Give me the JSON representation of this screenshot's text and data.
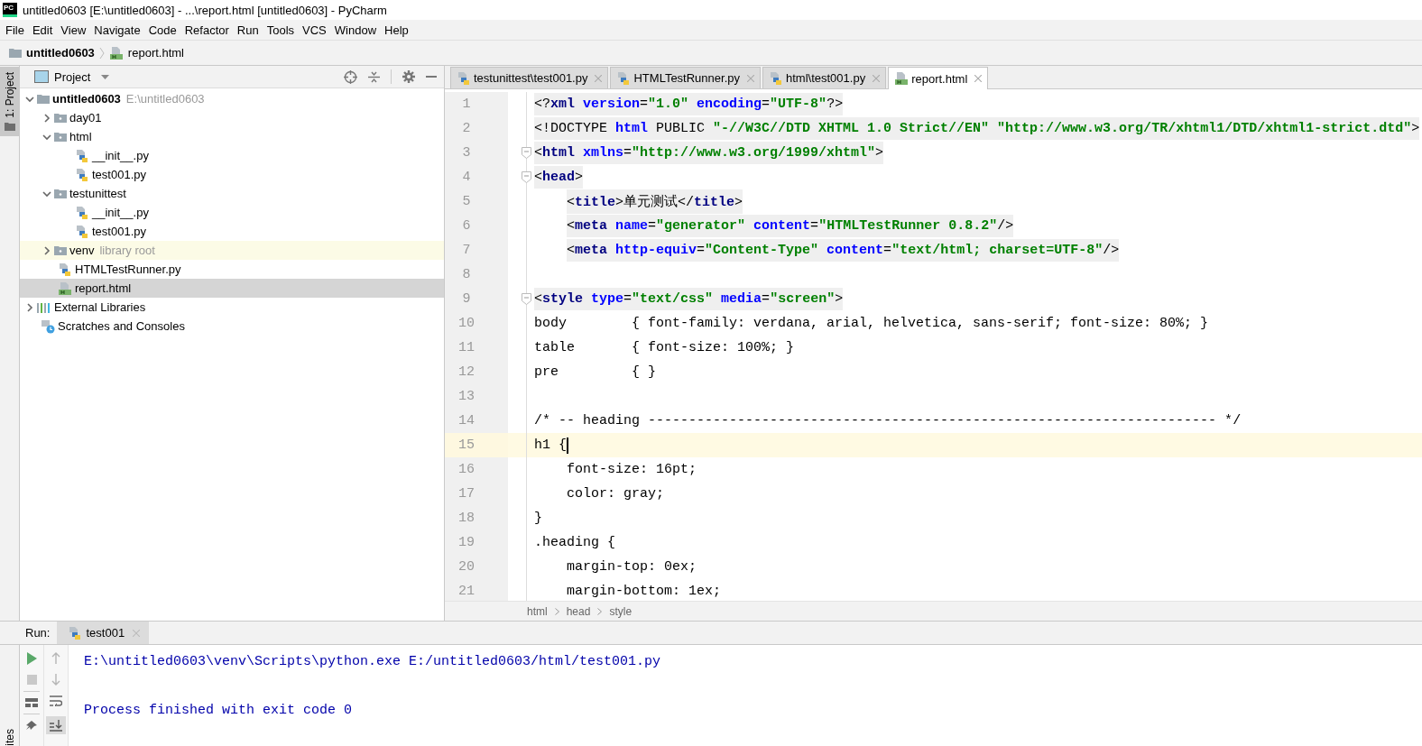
{
  "window": {
    "logo": "PC",
    "title": "untitled0603 [E:\\untitled0603] - ...\\report.html [untitled0603] - PyCharm"
  },
  "menu": [
    "File",
    "Edit",
    "View",
    "Navigate",
    "Code",
    "Refactor",
    "Run",
    "Tools",
    "VCS",
    "Window",
    "Help"
  ],
  "navigation": {
    "project": "untitled0603",
    "file": "report.html"
  },
  "left_stripe": {
    "tool": "1: Project",
    "bottom_tool": "ites"
  },
  "project_panel": {
    "title": "Project",
    "tree": [
      {
        "label": "untitled0603",
        "path": "E:\\untitled0603",
        "kind": "project",
        "expanded": true,
        "selected": false,
        "children": [
          {
            "label": "day01",
            "kind": "folder",
            "expanded": false,
            "selected": false
          },
          {
            "label": "html",
            "kind": "folder",
            "expanded": true,
            "selected": false,
            "children": [
              {
                "label": "__init__.py",
                "kind": "python",
                "selected": false
              },
              {
                "label": "test001.py",
                "kind": "python",
                "selected": false
              }
            ]
          },
          {
            "label": "testunittest",
            "kind": "folder",
            "expanded": true,
            "selected": false,
            "children": [
              {
                "label": "__init__.py",
                "kind": "python",
                "selected": false
              },
              {
                "label": "test001.py",
                "kind": "python",
                "selected": false
              }
            ]
          },
          {
            "label": "venv",
            "note": "library root",
            "kind": "folder",
            "expanded": false,
            "selected": false
          },
          {
            "label": "HTMLTestRunner.py",
            "kind": "python",
            "selected": false
          },
          {
            "label": "report.html",
            "kind": "html",
            "selected": true
          }
        ]
      },
      {
        "label": "External Libraries",
        "kind": "libraries",
        "expanded": false,
        "selected": false
      },
      {
        "label": "Scratches and Consoles",
        "kind": "scratches",
        "selected": false
      }
    ]
  },
  "editor": {
    "tabs": [
      {
        "label": "testunittest\\test001.py",
        "kind": "python",
        "selected": false
      },
      {
        "label": "HTMLTestRunner.py",
        "kind": "python",
        "selected": false
      },
      {
        "label": "html\\test001.py",
        "kind": "python",
        "selected": false
      },
      {
        "label": "report.html",
        "kind": "html",
        "selected": true
      }
    ],
    "lines": [
      {
        "number": "1",
        "shaded": true,
        "current": false,
        "fold": false,
        "tokens": [
          {
            "kind": "punct",
            "text": "<?"
          },
          {
            "kind": "tag",
            "text": "xml "
          },
          {
            "kind": "attr",
            "text": "version"
          },
          {
            "kind": "punct",
            "text": "="
          },
          {
            "kind": "str",
            "text": "\"1.0\" "
          },
          {
            "kind": "attr",
            "text": "encoding"
          },
          {
            "kind": "punct",
            "text": "="
          },
          {
            "kind": "str",
            "text": "\"UTF-8\""
          },
          {
            "kind": "punct",
            "text": "?>"
          }
        ]
      },
      {
        "number": "2",
        "shaded": true,
        "current": false,
        "fold": false,
        "tokens": [
          {
            "kind": "punct",
            "text": "<!DOCTYPE "
          },
          {
            "kind": "attr",
            "text": "html"
          },
          {
            "kind": "punct",
            "text": " PUBLIC "
          },
          {
            "kind": "str",
            "text": "\"-//W3C//DTD XHTML 1.0 Strict//EN\" \"http://www.w3.org/TR/xhtml1/DTD/xhtml1-strict.dtd\""
          },
          {
            "kind": "punct",
            "text": ">"
          }
        ]
      },
      {
        "number": "3",
        "shaded": true,
        "current": false,
        "fold": true,
        "tokens": [
          {
            "kind": "punct",
            "text": "<"
          },
          {
            "kind": "tag",
            "text": "html "
          },
          {
            "kind": "attr",
            "text": "xmlns"
          },
          {
            "kind": "punct",
            "text": "="
          },
          {
            "kind": "str",
            "text": "\"http://www.w3.org/1999/xhtml\""
          },
          {
            "kind": "punct",
            "text": ">"
          }
        ]
      },
      {
        "number": "4",
        "shaded": true,
        "current": false,
        "fold": true,
        "tokens": [
          {
            "kind": "punct",
            "text": "<"
          },
          {
            "kind": "tag",
            "text": "head"
          },
          {
            "kind": "punct",
            "text": ">"
          }
        ]
      },
      {
        "number": "5",
        "shaded": true,
        "current": false,
        "fold": false,
        "indent": true,
        "tokens": [
          {
            "kind": "punct",
            "text": "<"
          },
          {
            "kind": "tag",
            "text": "title"
          },
          {
            "kind": "punct",
            "text": ">单元测试</"
          },
          {
            "kind": "tag",
            "text": "title"
          },
          {
            "kind": "punct",
            "text": ">"
          }
        ]
      },
      {
        "number": "6",
        "shaded": true,
        "current": false,
        "fold": false,
        "indent": true,
        "tokens": [
          {
            "kind": "punct",
            "text": "<"
          },
          {
            "kind": "tag",
            "text": "meta "
          },
          {
            "kind": "attr",
            "text": "name"
          },
          {
            "kind": "punct",
            "text": "="
          },
          {
            "kind": "str",
            "text": "\"generator\" "
          },
          {
            "kind": "attr",
            "text": "content"
          },
          {
            "kind": "punct",
            "text": "="
          },
          {
            "kind": "str",
            "text": "\"HTMLTestRunner 0.8.2\""
          },
          {
            "kind": "punct",
            "text": "/>"
          }
        ]
      },
      {
        "number": "7",
        "shaded": true,
        "current": false,
        "fold": false,
        "indent": true,
        "tokens": [
          {
            "kind": "punct",
            "text": "<"
          },
          {
            "kind": "tag",
            "text": "meta "
          },
          {
            "kind": "attr",
            "text": "http-equiv"
          },
          {
            "kind": "punct",
            "text": "="
          },
          {
            "kind": "str",
            "text": "\"Content-Type\" "
          },
          {
            "kind": "attr",
            "text": "content"
          },
          {
            "kind": "punct",
            "text": "="
          },
          {
            "kind": "str",
            "text": "\"text/html; charset=UTF-8\""
          },
          {
            "kind": "punct",
            "text": "/>"
          }
        ]
      },
      {
        "number": "8",
        "current": false,
        "fold": false
      },
      {
        "number": "9",
        "shaded": true,
        "current": false,
        "fold": true,
        "tokens": [
          {
            "kind": "punct",
            "text": "<"
          },
          {
            "kind": "tag",
            "text": "style "
          },
          {
            "kind": "attr",
            "text": "type"
          },
          {
            "kind": "punct",
            "text": "="
          },
          {
            "kind": "str",
            "text": "\"text/css\" "
          },
          {
            "kind": "attr",
            "text": "media"
          },
          {
            "kind": "punct",
            "text": "="
          },
          {
            "kind": "str",
            "text": "\"screen\""
          },
          {
            "kind": "punct",
            "text": ">"
          }
        ]
      },
      {
        "number": "10",
        "shaded": false,
        "current": false,
        "fold": false,
        "tokens": [
          {
            "kind": "punct",
            "text": "body        { font-family: verdana, arial, helvetica, sans-serif; font-size: 80%; }"
          }
        ]
      },
      {
        "number": "11",
        "shaded": false,
        "current": false,
        "fold": false,
        "tokens": [
          {
            "kind": "punct",
            "text": "table       { font-size: 100%; }"
          }
        ]
      },
      {
        "number": "12",
        "shaded": false,
        "current": false,
        "fold": false,
        "tokens": [
          {
            "kind": "punct",
            "text": "pre         { }"
          }
        ]
      },
      {
        "number": "13",
        "current": false,
        "fold": false
      },
      {
        "number": "14",
        "shaded": false,
        "current": false,
        "fold": false,
        "tokens": [
          {
            "kind": "punct",
            "text": "/* -- heading ---------------------------------------------------------------------- */"
          }
        ]
      },
      {
        "number": "15",
        "shaded": false,
        "current": true,
        "fold": false,
        "tokens": [
          {
            "kind": "punct",
            "text": "h1 {"
          }
        ]
      },
      {
        "number": "16",
        "shaded": false,
        "current": false,
        "fold": false,
        "indent": true,
        "tokens": [
          {
            "kind": "punct",
            "text": "font-size: 16pt;"
          }
        ]
      },
      {
        "number": "17",
        "shaded": false,
        "current": false,
        "fold": false,
        "indent": true,
        "tokens": [
          {
            "kind": "punct",
            "text": "color: gray;"
          }
        ]
      },
      {
        "number": "18",
        "shaded": false,
        "current": false,
        "fold": false,
        "tokens": [
          {
            "kind": "punct",
            "text": "}"
          }
        ]
      },
      {
        "number": "19",
        "shaded": false,
        "current": false,
        "fold": false,
        "tokens": [
          {
            "kind": "punct",
            "text": ".heading {"
          }
        ]
      },
      {
        "number": "20",
        "shaded": false,
        "current": false,
        "fold": false,
        "indent": true,
        "tokens": [
          {
            "kind": "punct",
            "text": "margin-top: 0ex;"
          }
        ]
      },
      {
        "number": "21",
        "shaded": false,
        "current": false,
        "fold": false,
        "indent": true,
        "tokens": [
          {
            "kind": "punct",
            "text": "margin-bottom: 1ex;"
          }
        ]
      }
    ],
    "breadcrumbs": [
      "html",
      "head",
      "style"
    ]
  },
  "run_panel": {
    "label": "Run:",
    "tab": "test001",
    "output": [
      "E:\\untitled0603\\venv\\Scripts\\python.exe E:/untitled0603/html/test001.py",
      "Process finished with exit code 0"
    ]
  }
}
